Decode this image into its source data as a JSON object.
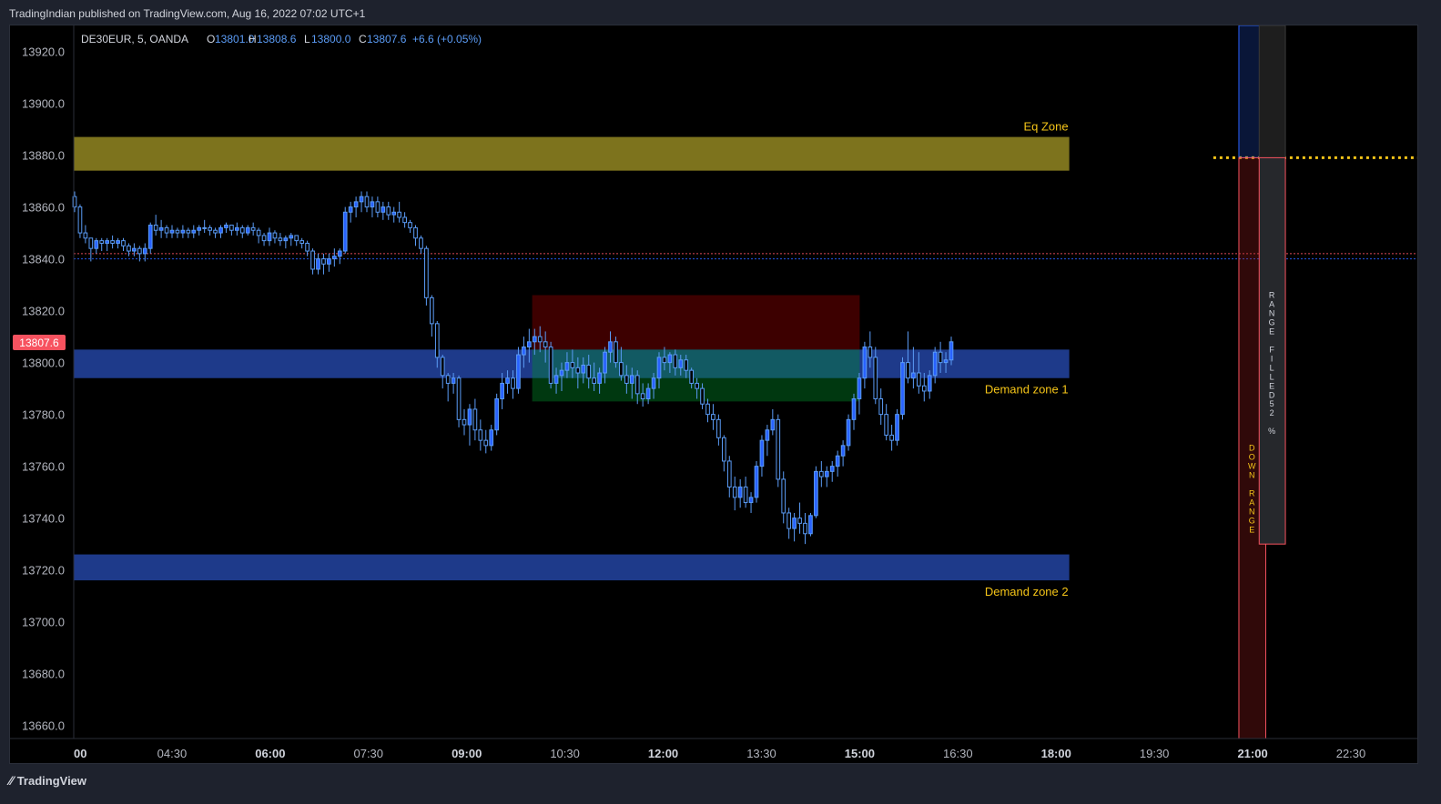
{
  "header": {
    "text": "TradingIndian published on TradingView.com, Aug 16, 2022 07:02 UTC+1"
  },
  "footer": {
    "brand": "TradingView"
  },
  "legend": {
    "symbol": "DE30EUR, 5, OANDA",
    "o_label": "O",
    "o": "13801.0",
    "h_label": "H",
    "h": "13808.6",
    "l_label": "L",
    "l": "13800.0",
    "c_label": "C",
    "c": "13807.6",
    "change": "+6.6 (+0.05%)"
  },
  "price_badge": {
    "value": "13807.6",
    "price": 13807.6,
    "color": "#f7525f"
  },
  "colors": {
    "up": "#2962ff",
    "down": "#2962ff",
    "wick": "#5b9cf6",
    "eq_zone": "#7d731d",
    "demand_zone": "#1e3a8a",
    "label": "#f5c518"
  },
  "chart_data": {
    "type": "candlestick",
    "ylim": [
      13655,
      13930
    ],
    "y_ticks": [
      13920.0,
      13900.0,
      13880.0,
      13860.0,
      13840.0,
      13820.0,
      13800.0,
      13780.0,
      13760.0,
      13740.0,
      13720.0,
      13700.0,
      13680.0,
      13660.0
    ],
    "y_tick_labels": [
      "13920.0",
      "13900.0",
      "13880.0",
      "13860.0",
      "13840.0",
      "13820.0",
      "13800.0",
      "13780.0",
      "13760.0",
      "13740.0",
      "13720.0",
      "13700.0",
      "13680.0",
      "13660.0"
    ],
    "x_ticks": [
      {
        "label": "00",
        "bold": true,
        "hour": 3.0
      },
      {
        "label": "04:30",
        "bold": false,
        "hour": 4.5
      },
      {
        "label": "06:00",
        "bold": true,
        "hour": 6.0
      },
      {
        "label": "07:30",
        "bold": false,
        "hour": 7.5
      },
      {
        "label": "09:00",
        "bold": true,
        "hour": 9.0
      },
      {
        "label": "10:30",
        "bold": false,
        "hour": 10.5
      },
      {
        "label": "12:00",
        "bold": true,
        "hour": 12.0
      },
      {
        "label": "13:30",
        "bold": false,
        "hour": 13.5
      },
      {
        "label": "15:00",
        "bold": true,
        "hour": 15.0
      },
      {
        "label": "16:30",
        "bold": false,
        "hour": 16.5
      },
      {
        "label": "18:00",
        "bold": true,
        "hour": 18.0
      },
      {
        "label": "19:30",
        "bold": false,
        "hour": 19.5
      },
      {
        "label": "21:00",
        "bold": true,
        "hour": 21.0
      },
      {
        "label": "22:30",
        "bold": false,
        "hour": 22.5
      }
    ],
    "zones": [
      {
        "label": "Eq Zone",
        "top": 13887,
        "bottom": 13874,
        "start_hour": 3.0,
        "end_hour": 18.2,
        "color": "#7d731d"
      },
      {
        "label": "Demand zone 1",
        "top": 13805,
        "bottom": 13794,
        "start_hour": 3.0,
        "end_hour": 18.2,
        "color": "#1e3a8a"
      },
      {
        "label": "Demand zone 2",
        "top": 13726,
        "bottom": 13716,
        "start_hour": 3.0,
        "end_hour": 18.2,
        "color": "#1e3a8a"
      }
    ],
    "position_tool": {
      "start_hour": 10.0,
      "end_hour": 15.0,
      "stop_top": 13826,
      "entry": 13805,
      "target": 13785
    },
    "hlines": [
      {
        "price": 13842,
        "color": "#f7525f",
        "style": "dotted"
      },
      {
        "price": 13840,
        "color": "#2962ff",
        "style": "dotted"
      },
      {
        "price": 13879,
        "color": "#f5c518",
        "style": "dotted-thick",
        "start_hour": 20.4
      }
    ],
    "range_indicator": {
      "up_box": {
        "start_hour": 20.79,
        "end_hour": 21.2,
        "top": 13930,
        "bottom": 13879
      },
      "down_box": {
        "start_hour": 20.79,
        "end_hour": 21.2,
        "top": 13879,
        "bottom": 13655
      },
      "filled_box": {
        "start_hour": 21.1,
        "end_hour": 21.5,
        "top": 13930,
        "bottom": 13879
      },
      "filled_bar": {
        "start_hour": 21.1,
        "end_hour": 21.5,
        "top": 13879,
        "bottom": 13730
      },
      "down_label": "DOWN RANGE",
      "filled_label": "RANGE FILLED",
      "filled_percent": "52 %"
    },
    "candles": [
      [
        13864,
        13866,
        13858,
        13860
      ],
      [
        13860,
        13861,
        13848,
        13850
      ],
      [
        13850,
        13853,
        13846,
        13848
      ],
      [
        13848,
        13848,
        13839,
        13844
      ],
      [
        13844,
        13848,
        13842,
        13847
      ],
      [
        13847,
        13848,
        13843,
        13846
      ],
      [
        13846,
        13848,
        13843,
        13847
      ],
      [
        13847,
        13849,
        13844,
        13846
      ],
      [
        13846,
        13848,
        13844,
        13847
      ],
      [
        13847,
        13848,
        13843,
        13845
      ],
      [
        13845,
        13846,
        13841,
        13843
      ],
      [
        13843,
        13846,
        13841,
        13844
      ],
      [
        13844,
        13845,
        13839,
        13842
      ],
      [
        13842,
        13846,
        13839,
        13844
      ],
      [
        13844,
        13854,
        13842,
        13853
      ],
      [
        13853,
        13857,
        13849,
        13851
      ],
      [
        13851,
        13855,
        13848,
        13852
      ],
      [
        13852,
        13853,
        13848,
        13850
      ],
      [
        13850,
        13853,
        13848,
        13851
      ],
      [
        13851,
        13852,
        13848,
        13850
      ],
      [
        13850,
        13853,
        13848,
        13851
      ],
      [
        13851,
        13852,
        13848,
        13850
      ],
      [
        13850,
        13853,
        13848,
        13851
      ],
      [
        13851,
        13853,
        13849,
        13852
      ],
      [
        13852,
        13855,
        13850,
        13852
      ],
      [
        13852,
        13853,
        13849,
        13851
      ],
      [
        13851,
        13852,
        13848,
        13850
      ],
      [
        13850,
        13853,
        13848,
        13852
      ],
      [
        13852,
        13854,
        13850,
        13853
      ],
      [
        13853,
        13853,
        13849,
        13851
      ],
      [
        13851,
        13854,
        13849,
        13852
      ],
      [
        13852,
        13853,
        13848,
        13850
      ],
      [
        13850,
        13853,
        13849,
        13852
      ],
      [
        13852,
        13854,
        13849,
        13851
      ],
      [
        13851,
        13852,
        13846,
        13849
      ],
      [
        13849,
        13850,
        13845,
        13847
      ],
      [
        13847,
        13852,
        13845,
        13850
      ],
      [
        13850,
        13851,
        13846,
        13848
      ],
      [
        13848,
        13850,
        13845,
        13847
      ],
      [
        13847,
        13849,
        13844,
        13848
      ],
      [
        13848,
        13850,
        13845,
        13849
      ],
      [
        13849,
        13849,
        13845,
        13847
      ],
      [
        13847,
        13848,
        13844,
        13846
      ],
      [
        13846,
        13847,
        13841,
        13843
      ],
      [
        13843,
        13844,
        13834,
        13836
      ],
      [
        13836,
        13842,
        13834,
        13840
      ],
      [
        13840,
        13842,
        13834,
        13838
      ],
      [
        13838,
        13842,
        13835,
        13840
      ],
      [
        13840,
        13844,
        13837,
        13841
      ],
      [
        13841,
        13844,
        13838,
        13843
      ],
      [
        13843,
        13860,
        13842,
        13858
      ],
      [
        13858,
        13862,
        13854,
        13860
      ],
      [
        13860,
        13864,
        13856,
        13862
      ],
      [
        13862,
        13866,
        13858,
        13864
      ],
      [
        13864,
        13866,
        13858,
        13860
      ],
      [
        13860,
        13864,
        13856,
        13862
      ],
      [
        13862,
        13864,
        13856,
        13858
      ],
      [
        13858,
        13862,
        13855,
        13860
      ],
      [
        13860,
        13862,
        13855,
        13857
      ],
      [
        13857,
        13860,
        13854,
        13858
      ],
      [
        13858,
        13862,
        13854,
        13856
      ],
      [
        13856,
        13858,
        13852,
        13854
      ],
      [
        13854,
        13855,
        13850,
        13852
      ],
      [
        13852,
        13853,
        13845,
        13848
      ],
      [
        13848,
        13849,
        13842,
        13844
      ],
      [
        13844,
        13845,
        13822,
        13825
      ],
      [
        13825,
        13826,
        13810,
        13815
      ],
      [
        13815,
        13816,
        13798,
        13802
      ],
      [
        13802,
        13803,
        13790,
        13795
      ],
      [
        13795,
        13796,
        13785,
        13792
      ],
      [
        13792,
        13796,
        13788,
        13794
      ],
      [
        13794,
        13795,
        13775,
        13778
      ],
      [
        13778,
        13782,
        13772,
        13776
      ],
      [
        13776,
        13784,
        13768,
        13782
      ],
      [
        13782,
        13786,
        13770,
        13774
      ],
      [
        13774,
        13778,
        13766,
        13770
      ],
      [
        13770,
        13774,
        13765,
        13768
      ],
      [
        13768,
        13776,
        13766,
        13774
      ],
      [
        13774,
        13788,
        13772,
        13786
      ],
      [
        13786,
        13796,
        13782,
        13792
      ],
      [
        13792,
        13797,
        13788,
        13794
      ],
      [
        13794,
        13797,
        13786,
        13790
      ],
      [
        13790,
        13806,
        13788,
        13803
      ],
      [
        13803,
        13810,
        13798,
        13806
      ],
      [
        13806,
        13813,
        13800,
        13808
      ],
      [
        13808,
        13813,
        13803,
        13810
      ],
      [
        13810,
        13814,
        13804,
        13808
      ],
      [
        13808,
        13812,
        13800,
        13806
      ],
      [
        13806,
        13808,
        13790,
        13792
      ],
      [
        13792,
        13798,
        13788,
        13795
      ],
      [
        13795,
        13800,
        13789,
        13797
      ],
      [
        13797,
        13804,
        13794,
        13800
      ],
      [
        13800,
        13805,
        13794,
        13798
      ],
      [
        13798,
        13802,
        13790,
        13796
      ],
      [
        13796,
        13802,
        13792,
        13799
      ],
      [
        13799,
        13803,
        13790,
        13794
      ],
      [
        13794,
        13800,
        13789,
        13792
      ],
      [
        13792,
        13798,
        13788,
        13796
      ],
      [
        13796,
        13806,
        13792,
        13804
      ],
      [
        13804,
        13812,
        13800,
        13808
      ],
      [
        13808,
        13810,
        13798,
        13800
      ],
      [
        13800,
        13806,
        13793,
        13795
      ],
      [
        13795,
        13799,
        13788,
        13792
      ],
      [
        13792,
        13798,
        13786,
        13795
      ],
      [
        13795,
        13797,
        13784,
        13788
      ],
      [
        13788,
        13792,
        13783,
        13786
      ],
      [
        13786,
        13792,
        13784,
        13790
      ],
      [
        13790,
        13796,
        13786,
        13794
      ],
      [
        13794,
        13804,
        13790,
        13802
      ],
      [
        13802,
        13806,
        13797,
        13800
      ],
      [
        13800,
        13804,
        13796,
        13803
      ],
      [
        13803,
        13805,
        13795,
        13798
      ],
      [
        13798,
        13803,
        13795,
        13801
      ],
      [
        13801,
        13803,
        13794,
        13797
      ],
      [
        13797,
        13798,
        13790,
        13792
      ],
      [
        13792,
        13794,
        13786,
        13790
      ],
      [
        13790,
        13792,
        13782,
        13784
      ],
      [
        13784,
        13786,
        13777,
        13780
      ],
      [
        13780,
        13784,
        13774,
        13778
      ],
      [
        13778,
        13780,
        13768,
        13771
      ],
      [
        13771,
        13772,
        13758,
        13762
      ],
      [
        13762,
        13764,
        13748,
        13752
      ],
      [
        13752,
        13756,
        13743,
        13748
      ],
      [
        13748,
        13755,
        13744,
        13752
      ],
      [
        13752,
        13756,
        13744,
        13746
      ],
      [
        13746,
        13750,
        13742,
        13748
      ],
      [
        13748,
        13762,
        13746,
        13760
      ],
      [
        13760,
        13772,
        13756,
        13770
      ],
      [
        13770,
        13776,
        13764,
        13774
      ],
      [
        13774,
        13782,
        13772,
        13778
      ],
      [
        13778,
        13780,
        13752,
        13755
      ],
      [
        13755,
        13758,
        13738,
        13742
      ],
      [
        13742,
        13744,
        13732,
        13736
      ],
      [
        13736,
        13742,
        13731,
        13740
      ],
      [
        13740,
        13746,
        13734,
        13738
      ],
      [
        13738,
        13742,
        13730,
        13734
      ],
      [
        13734,
        13742,
        13733,
        13741
      ],
      [
        13741,
        13760,
        13740,
        13758
      ],
      [
        13758,
        13762,
        13752,
        13756
      ],
      [
        13756,
        13760,
        13752,
        13758
      ],
      [
        13758,
        13762,
        13754,
        13760
      ],
      [
        13760,
        13766,
        13756,
        13764
      ],
      [
        13764,
        13770,
        13760,
        13768
      ],
      [
        13768,
        13780,
        13766,
        13778
      ],
      [
        13778,
        13788,
        13774,
        13786
      ],
      [
        13786,
        13796,
        13780,
        13794
      ],
      [
        13794,
        13808,
        13790,
        13806
      ],
      [
        13806,
        13812,
        13798,
        13802
      ],
      [
        13802,
        13806,
        13784,
        13786
      ],
      [
        13786,
        13790,
        13776,
        13780
      ],
      [
        13780,
        13784,
        13770,
        13772
      ],
      [
        13772,
        13776,
        13766,
        13770
      ],
      [
        13770,
        13782,
        13768,
        13780
      ],
      [
        13780,
        13802,
        13778,
        13800
      ],
      [
        13800,
        13812,
        13792,
        13794
      ],
      [
        13794,
        13806,
        13790,
        13796
      ],
      [
        13796,
        13804,
        13788,
        13791
      ],
      [
        13791,
        13796,
        13785,
        13789
      ],
      [
        13789,
        13797,
        13786,
        13795
      ],
      [
        13795,
        13806,
        13792,
        13804
      ],
      [
        13804,
        13808,
        13796,
        13800
      ],
      [
        13800,
        13804,
        13796,
        13801
      ],
      [
        13801,
        13810,
        13799,
        13808
      ]
    ]
  }
}
